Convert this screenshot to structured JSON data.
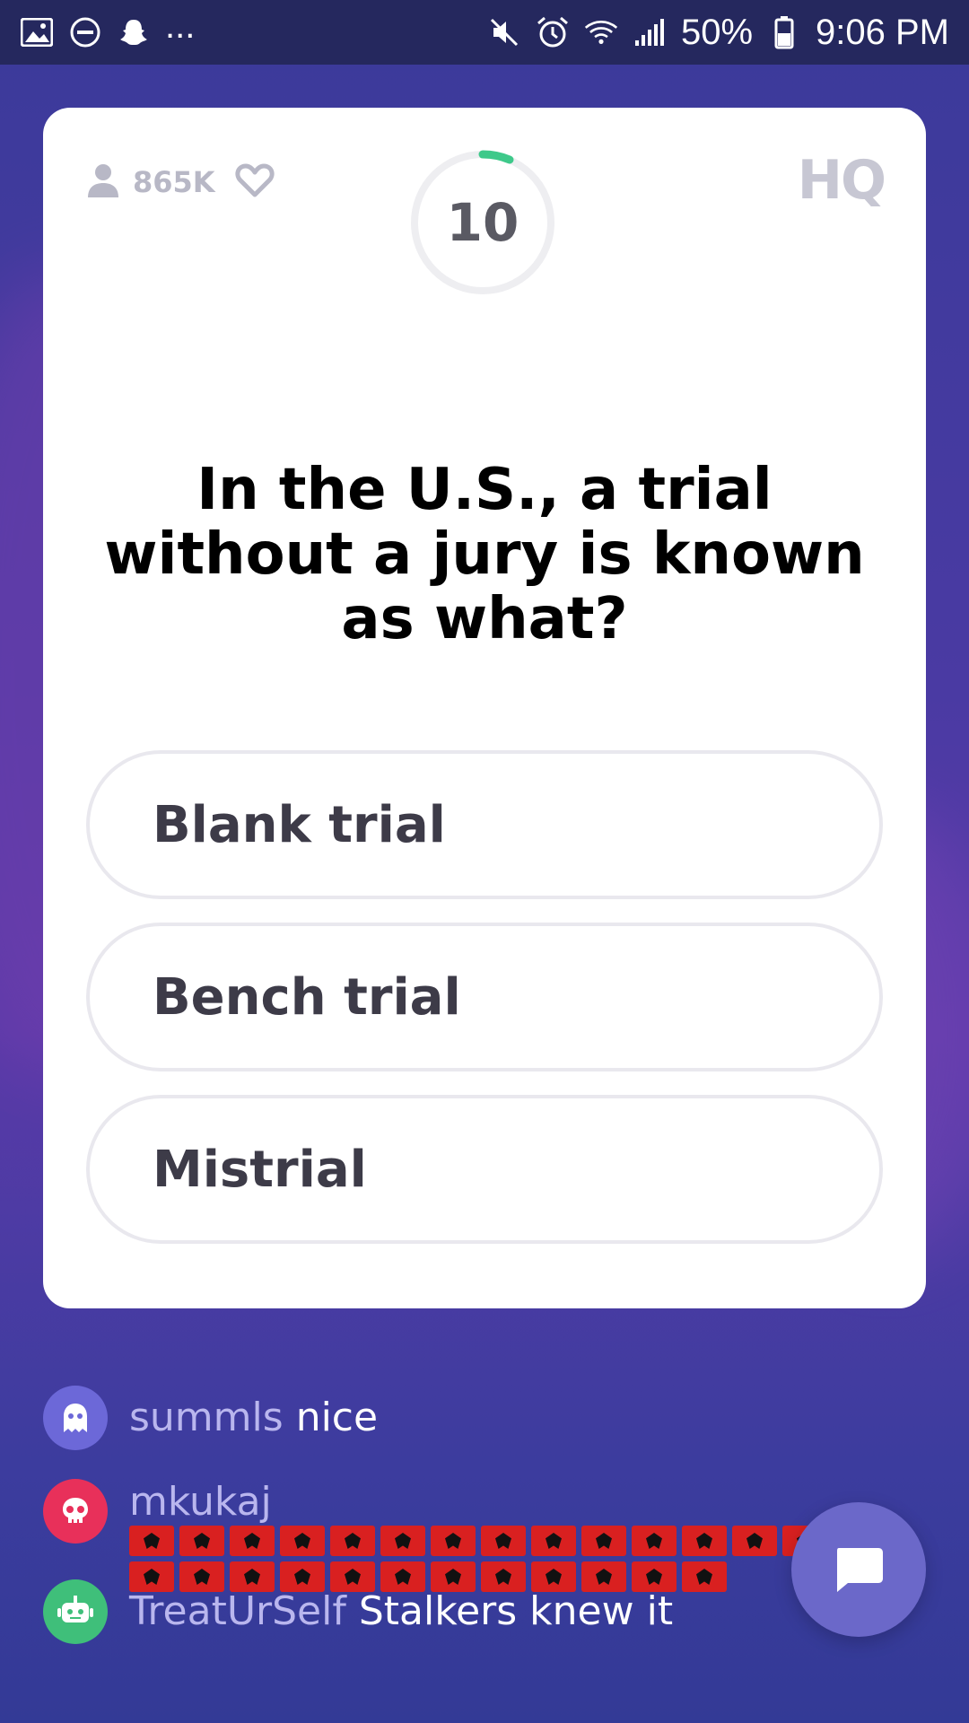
{
  "status_bar": {
    "left_icons": [
      "image-icon",
      "do-not-disturb-icon",
      "snapchat-ghost-icon"
    ],
    "overflow": "...",
    "right_icons": [
      "mute-icon",
      "alarm-icon",
      "wifi-icon",
      "signal-icon",
      "battery-icon"
    ],
    "battery": "50%",
    "time": "9:06 PM"
  },
  "card": {
    "viewer_count": "865K",
    "timer": "10",
    "logo": "HQ",
    "question": "In the U.S., a trial without a jury is known as what?",
    "answers": [
      {
        "label": "Blank trial"
      },
      {
        "label": "Bench trial"
      },
      {
        "label": "Mistrial"
      }
    ]
  },
  "chat": [
    {
      "user": "summls",
      "message": "nice",
      "avatar_color": "#6c68d8",
      "avatar_icon": "ghost-icon"
    },
    {
      "user": "mkukaj",
      "message": "",
      "flag_count": 26,
      "avatar_color": "#e8305a",
      "avatar_icon": "skull-icon"
    },
    {
      "user": "TreatUrSelf",
      "message": "Stalkers knew it",
      "avatar_color": "#3fbf7a",
      "avatar_icon": "robot-icon"
    }
  ],
  "colors": {
    "timer_progress": "#3ec98a",
    "chat_fab": "#6b68c9"
  }
}
